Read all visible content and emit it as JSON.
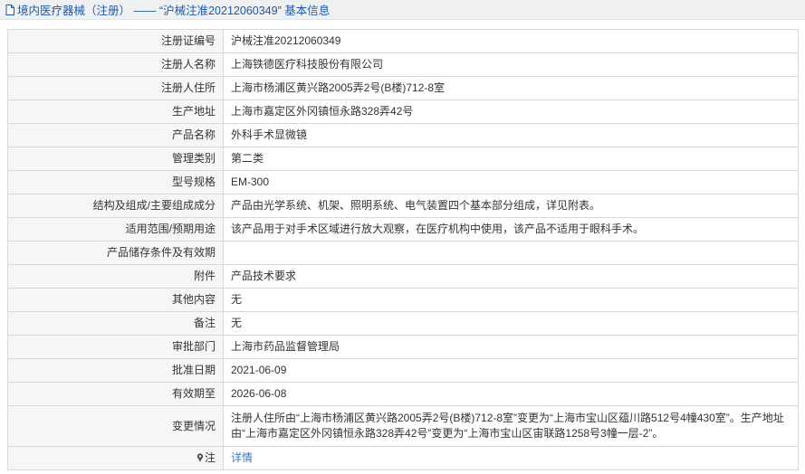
{
  "header": {
    "title": "境内医疗器械（注册） —— “沪械注准20212060349” 基本信息",
    "icon": "document-icon"
  },
  "rows": [
    {
      "label": "注册证编号",
      "value": "沪械注准20212060349"
    },
    {
      "label": "注册人名称",
      "value": "上海铁德医疗科技股份有限公司"
    },
    {
      "label": "注册人住所",
      "value": "上海市杨浦区黄兴路2005弄2号(B楼)712-8室"
    },
    {
      "label": "生产地址",
      "value": "上海市嘉定区外冈镇恒永路328弄42号"
    },
    {
      "label": "产品名称",
      "value": "外科手术显微镜"
    },
    {
      "label": "管理类别",
      "value": "第二类"
    },
    {
      "label": "型号规格",
      "value": "EM-300"
    },
    {
      "label": "结构及组成/主要组成成分",
      "value": "产品由光学系统、机架、照明系统、电气装置四个基本部分组成，详见附表。"
    },
    {
      "label": "适用范围/预期用途",
      "value": "该产品用于对手术区域进行放大观察，在医疗机构中使用，该产品不适用于眼科手术。"
    },
    {
      "label": "产品储存条件及有效期",
      "value": ""
    },
    {
      "label": "附件",
      "value": "产品技术要求"
    },
    {
      "label": "其他内容",
      "value": "无"
    },
    {
      "label": "备注",
      "value": "无"
    },
    {
      "label": "审批部门",
      "value": "上海市药品监督管理局"
    },
    {
      "label": "批准日期",
      "value": "2021-06-09"
    },
    {
      "label": "有效期至",
      "value": "2026-06-08"
    },
    {
      "label": "变更情况",
      "value": "注册人住所由“上海市杨浦区黄兴路2005弄2号(B楼)712-8室”变更为“上海市宝山区蕴川路512号4幢430室”。生产地址由“上海市嘉定区外冈镇恒永路328弄42号”变更为“上海市宝山区宙联路1258号3幢一层-2”。"
    }
  ],
  "note_row": {
    "label": "注",
    "icon": "pin-icon",
    "link_text": "详情"
  }
}
